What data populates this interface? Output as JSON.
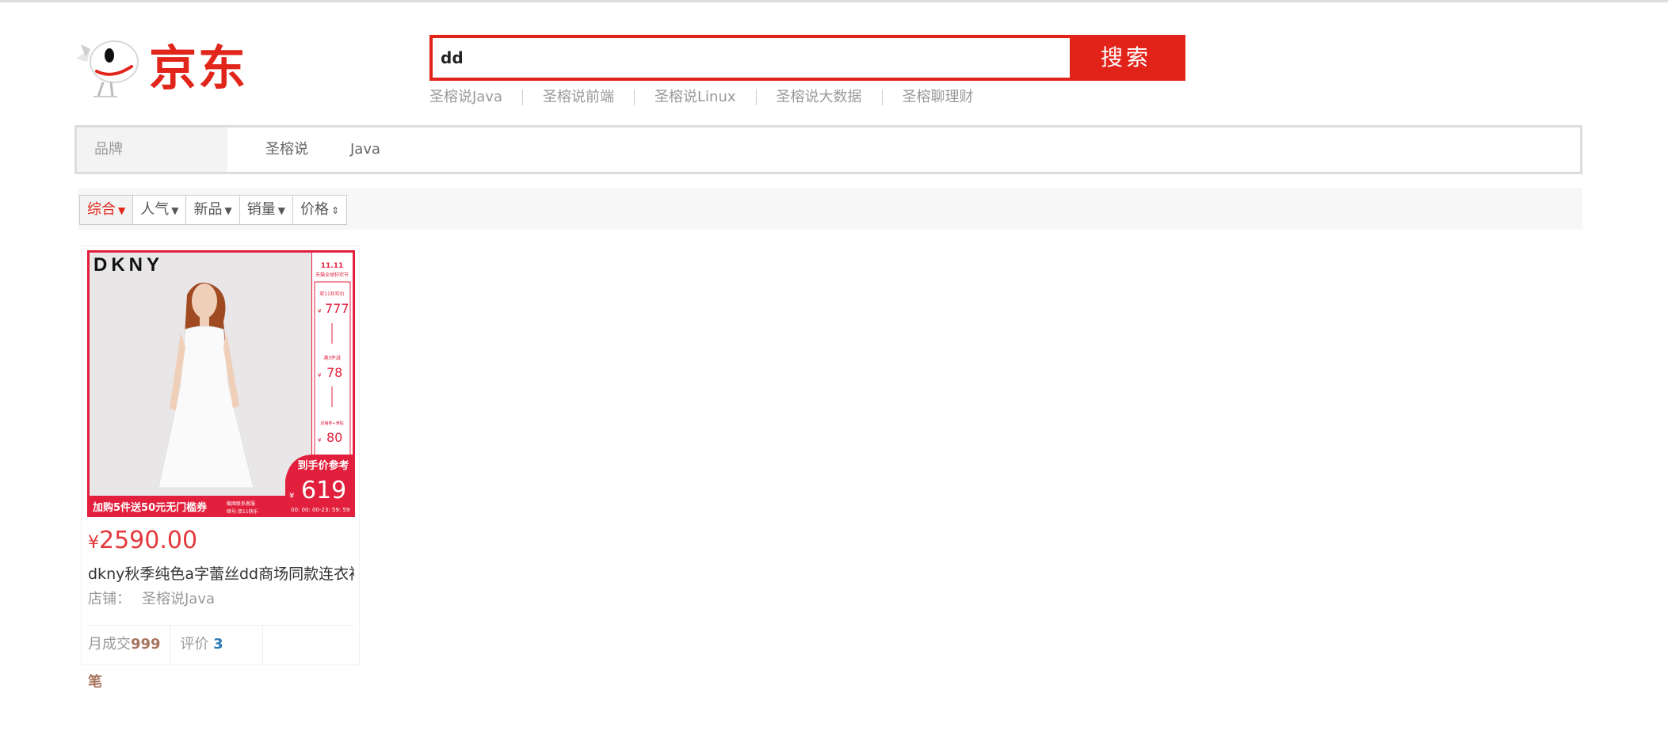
{
  "header": {
    "logo_text": "京东",
    "search": {
      "value": "dd",
      "button": "搜索"
    },
    "hotwords": [
      "圣榕说Java",
      "圣榕说前端",
      "圣榕说Linux",
      "圣榕说大数据",
      "圣榕聊理财"
    ]
  },
  "brand_bar": {
    "label": "品牌",
    "items": [
      "圣榕说",
      "Java"
    ]
  },
  "sort_bar": {
    "items": [
      {
        "label": "综合",
        "icon": "arrow-down-icon",
        "active": true
      },
      {
        "label": "人气",
        "icon": "arrow-down-icon"
      },
      {
        "label": "新品",
        "icon": "arrow-down-icon"
      },
      {
        "label": "销量",
        "icon": "arrow-down-icon"
      },
      {
        "label": "价格",
        "icon": "sort-up-down-icon"
      }
    ]
  },
  "product": {
    "image": {
      "brand": "DKNY",
      "festival": "天猫全球狂欢节",
      "price_label_1": "双11狂欢价",
      "price_1": "777",
      "price_label_2": "满3件减",
      "price_2": "78",
      "price_label_3": "店铺券+津贴",
      "price_3": "80",
      "final_label": "到手价参考",
      "final_price": "619",
      "countdown": "00: 00: 00-23: 59: 59",
      "promo": "加购5件送50元无门槛券",
      "promo_note_1": "截图联系客服",
      "promo_note_2": "暗号:双11快乐",
      "currency": "¥"
    },
    "currency": "¥",
    "price": "2590.00",
    "title": "dkny秋季纯色a字蕾丝dd商场同款连衣裙",
    "shop_label": "店铺：",
    "shop_name": "圣榕说Java",
    "monthly_sales_label": "月成交",
    "monthly_sales": "999笔",
    "reviews_label": "评价",
    "reviews": "3"
  },
  "colors": {
    "brand_red": "#e2231a",
    "price_red": "#e4393c",
    "review_blue": "#2b7bb9"
  }
}
